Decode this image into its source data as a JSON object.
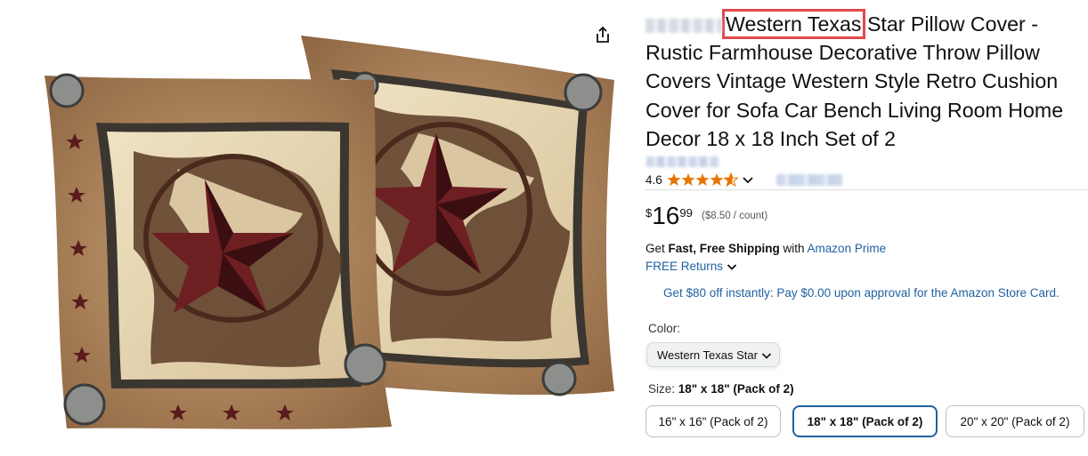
{
  "product": {
    "title_highlight": "Western Texas",
    "title_rest": " Star Pillow Cover - Rustic Farmhouse Decorative Throw Pillow Covers Vintage Western Style Retro Cushion Cover for Sofa Car Bench Living Room Home Decor 18 x 18 Inch Set of 2",
    "rating": "4.6",
    "rating_value": 4.6,
    "rating_max": 5,
    "price_symbol": "$",
    "price_whole": "16",
    "price_fraction": "99",
    "unit_price": "($8.50 / count)"
  },
  "shipping": {
    "prefix": "Get ",
    "bold": "Fast, Free Shipping",
    "middle": " with ",
    "prime_link": "Amazon Prime",
    "returns_link": "FREE Returns"
  },
  "promo": "Get $80 off instantly: Pay $0.00 upon approval for the Amazon Store Card.",
  "color": {
    "label": "Color:",
    "selected": "Western Texas Star"
  },
  "size": {
    "label": "Size: ",
    "selected": "18\" x 18\" (Pack of 2)",
    "options": [
      "16\" x 16\" (Pack of 2)",
      "18\" x 18\" (Pack of 2)",
      "20\" x 20\" (Pack of 2)"
    ]
  },
  "colors": {
    "star_fill": "#e77600",
    "link": "#2162a1",
    "highlight_box": "#e2484c",
    "selected_border": "#2162a1"
  },
  "icons": [
    "share-icon",
    "star-icon",
    "chevron-down-icon"
  ]
}
